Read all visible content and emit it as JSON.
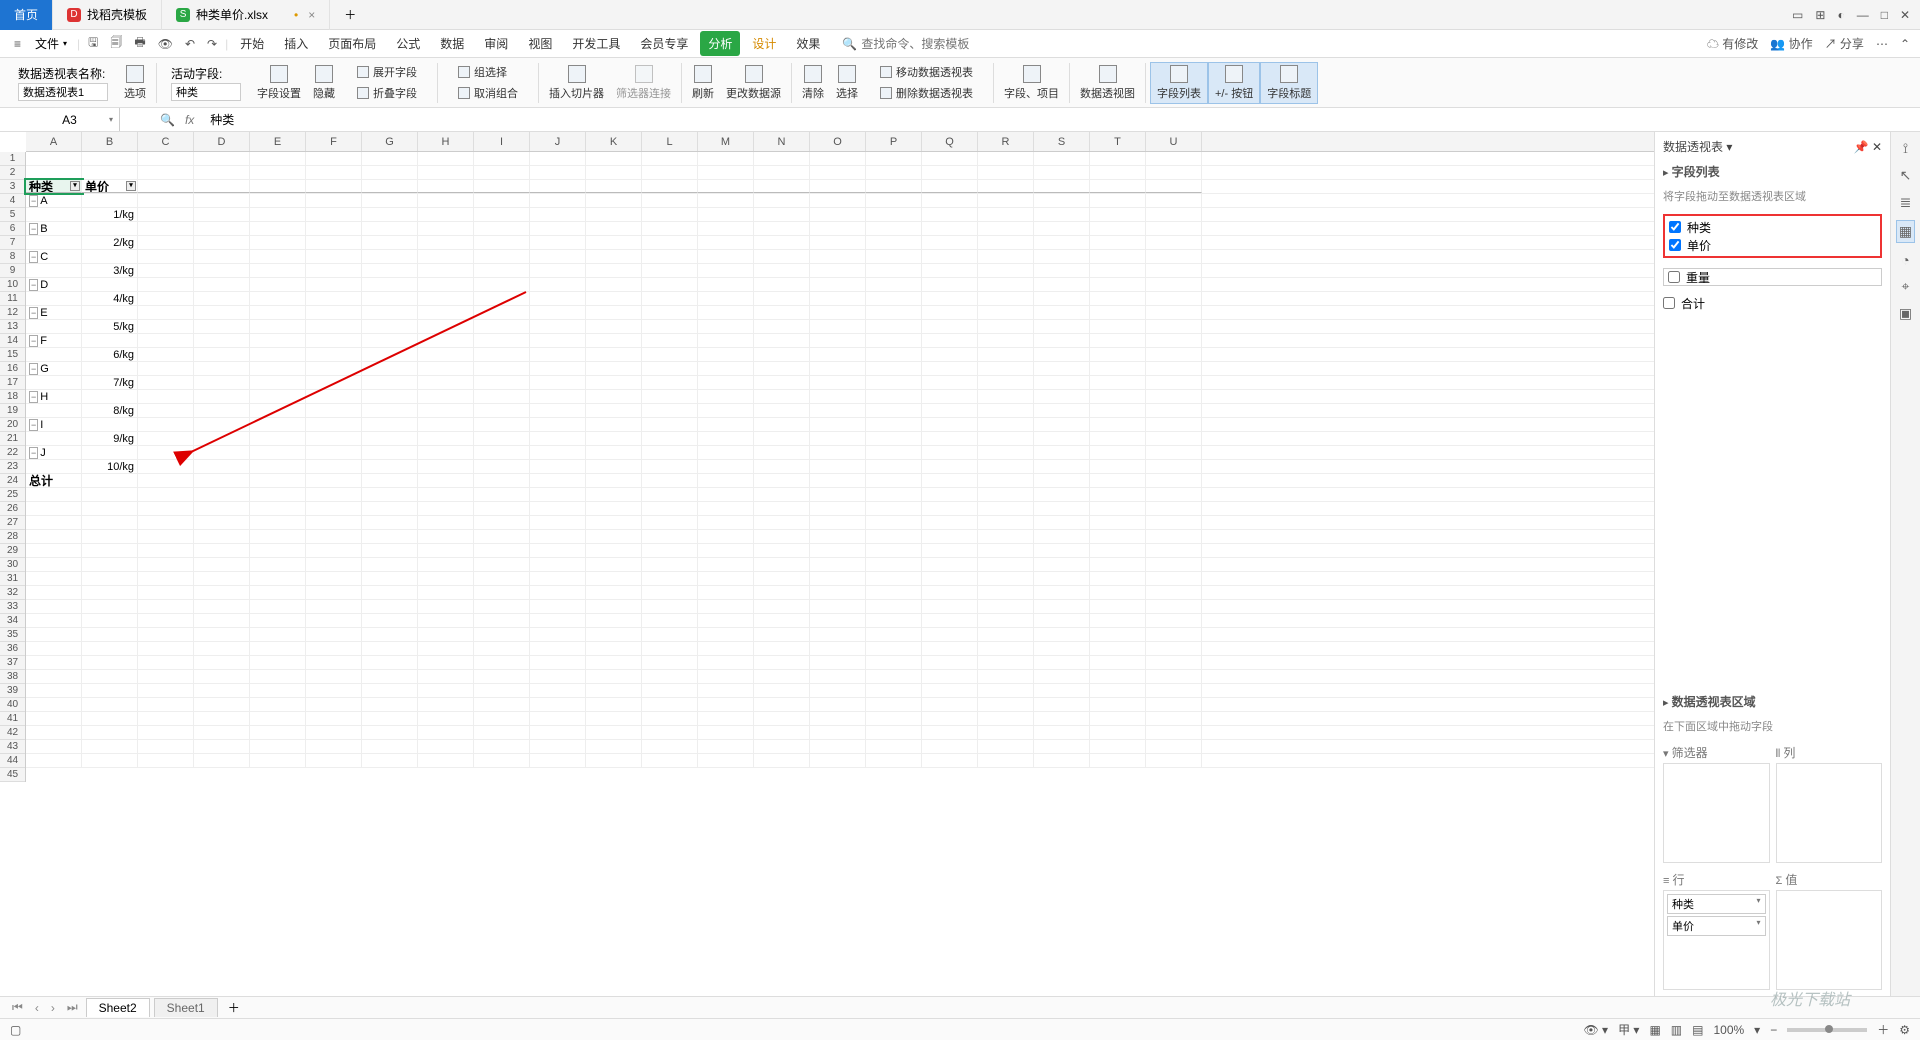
{
  "tabs": {
    "home": "首页",
    "t2": "找稻壳模板",
    "t3": "种类单价.xlsx"
  },
  "file": "文件",
  "menutabs": {
    "start": "开始",
    "insert": "插入",
    "layout": "页面布局",
    "formula": "公式",
    "data": "数据",
    "review": "审阅",
    "view": "视图",
    "dev": "开发工具",
    "vip": "会员专享",
    "analysis": "分析",
    "design": "设计",
    "effect": "效果"
  },
  "search_ph": "查找命令、搜索模板",
  "rightmenu": {
    "modify": "有修改",
    "collab": "协作",
    "share": "分享"
  },
  "toolbar": {
    "pt_name_lbl": "数据透视表名称:",
    "pt_name_val": "数据透视表1",
    "options": "选项",
    "active_field_lbl": "活动字段:",
    "active_field_val": "种类",
    "fieldset": "字段设置",
    "hide": "隐藏",
    "expand": "展开字段",
    "collapse": "折叠字段",
    "groupsel": "组选择",
    "ungroup": "取消组合",
    "slicer": "插入切片器",
    "filterlink": "筛选器连接",
    "refresh": "刷新",
    "changesrc": "更改数据源",
    "clear": "清除",
    "select": "选择",
    "movept": "移动数据透视表",
    "delpt": "删除数据透视表",
    "field": "字段、项目",
    "ptchart": "数据透视图",
    "fieldlist": "字段列表",
    "pmbtn": "+/- 按钮",
    "fieldlabel": "字段标题"
  },
  "formula": {
    "cell": "A3",
    "fx": "fx",
    "value": "种类"
  },
  "cols": [
    "A",
    "B",
    "C",
    "D",
    "E",
    "F",
    "G",
    "H",
    "I",
    "J",
    "K",
    "L",
    "M",
    "N",
    "O",
    "P",
    "Q",
    "R",
    "S",
    "T",
    "U"
  ],
  "sheet": {
    "hdr_a": "种类",
    "hdr_b": "单价",
    "rows": [
      {
        "a": "A",
        "b": "1/kg"
      },
      {
        "a": "B",
        "b": "2/kg"
      },
      {
        "a": "C",
        "b": "3/kg"
      },
      {
        "a": "D",
        "b": "4/kg"
      },
      {
        "a": "E",
        "b": "5/kg"
      },
      {
        "a": "F",
        "b": "6/kg"
      },
      {
        "a": "G",
        "b": "7/kg"
      },
      {
        "a": "H",
        "b": "8/kg"
      },
      {
        "a": "I",
        "b": "9/kg"
      },
      {
        "a": "J",
        "b": "10/kg"
      }
    ],
    "total": "总计"
  },
  "rpanel": {
    "title": "数据透视表",
    "fields_title": "字段列表",
    "drag_hint": "将字段拖动至数据透视表区域",
    "f1": "种类",
    "f2": "单价",
    "f3": "重量",
    "f4": "合计",
    "area_title": "数据透视表区域",
    "area_hint": "在下面区域中拖动字段",
    "filter": "筛选器",
    "col": "列",
    "row": "行",
    "val": "值",
    "row1": "种类",
    "row2": "单价"
  },
  "sheets": {
    "s2": "Sheet2",
    "s1": "Sheet1"
  },
  "status": {
    "zoom": "100%"
  },
  "watermark": "极光下载站"
}
